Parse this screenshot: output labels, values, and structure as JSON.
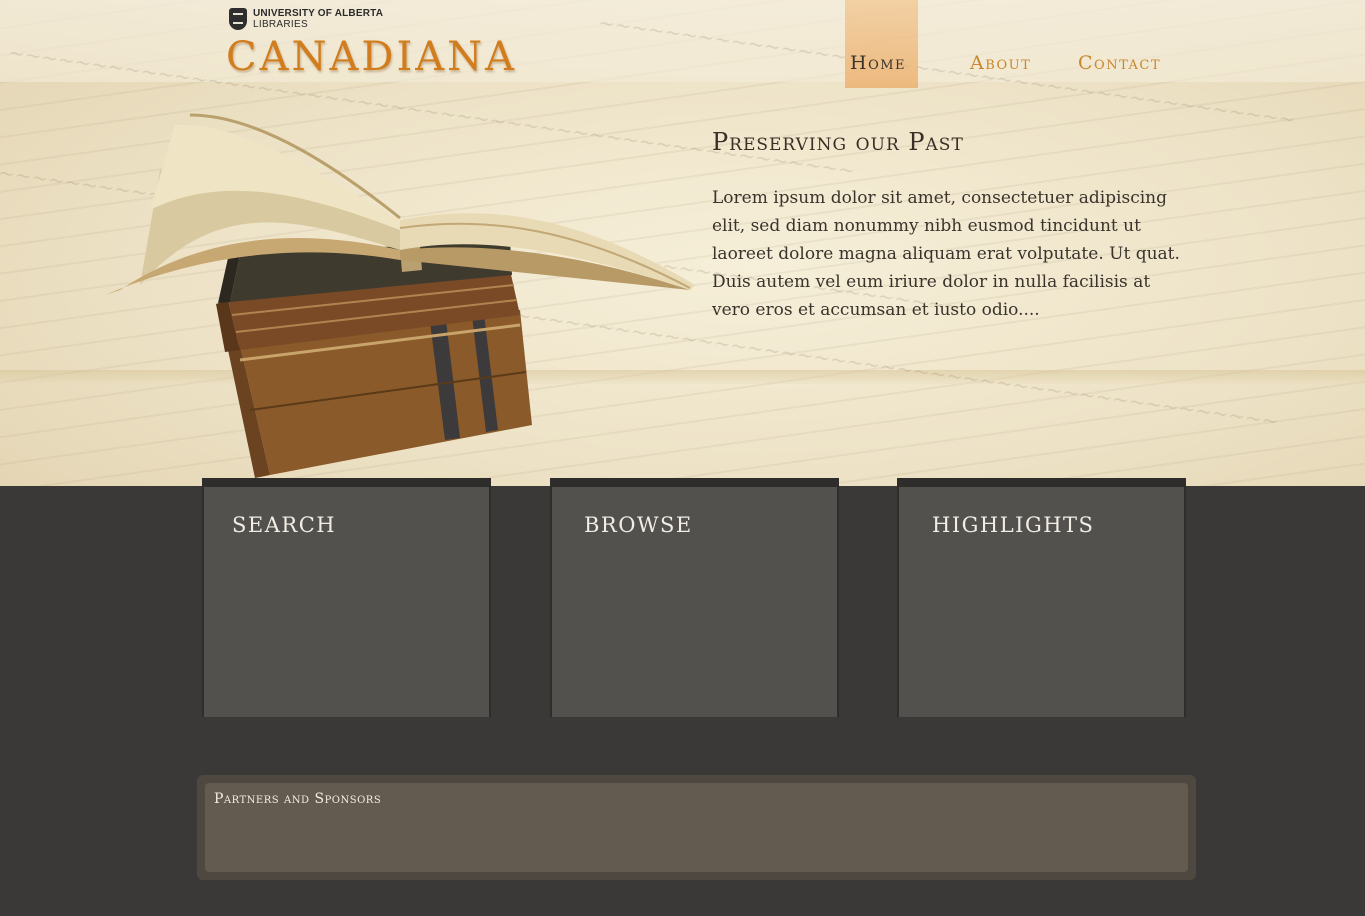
{
  "header": {
    "institution_line1": "UNIVERSITY OF ALBERTA",
    "institution_line2": "LIBRARIES",
    "site_title": "CANADIANA"
  },
  "nav": {
    "items": [
      {
        "label": "Home",
        "active": true
      },
      {
        "label": "About",
        "active": false
      },
      {
        "label": "Contact",
        "active": false
      }
    ]
  },
  "intro": {
    "title": "Preserving our Past",
    "body": "Lorem ipsum dolor sit amet, consectetuer adipiscing elit, sed diam nonummy nibh eusmod tincidunt ut laoreet dolore magna aliquam erat volputate. Ut quat. Duis autem vel eum iriure dolor in nulla facilisis at vero eros et accumsan et iusto odio...."
  },
  "panels": [
    {
      "title": "SEARCH"
    },
    {
      "title": "BROWSE"
    },
    {
      "title": "HIGHLIGHTS"
    }
  ],
  "partners": {
    "title": "Partners and Sponsors"
  },
  "colors": {
    "accent": "#d17d1e",
    "page_bg": "#3a3937",
    "panel_bg": "#52514e",
    "partners_bg": "#645b50"
  },
  "icons": {
    "institution_logo": "shield-icon",
    "hero_image": "stacked-books-illustration"
  }
}
